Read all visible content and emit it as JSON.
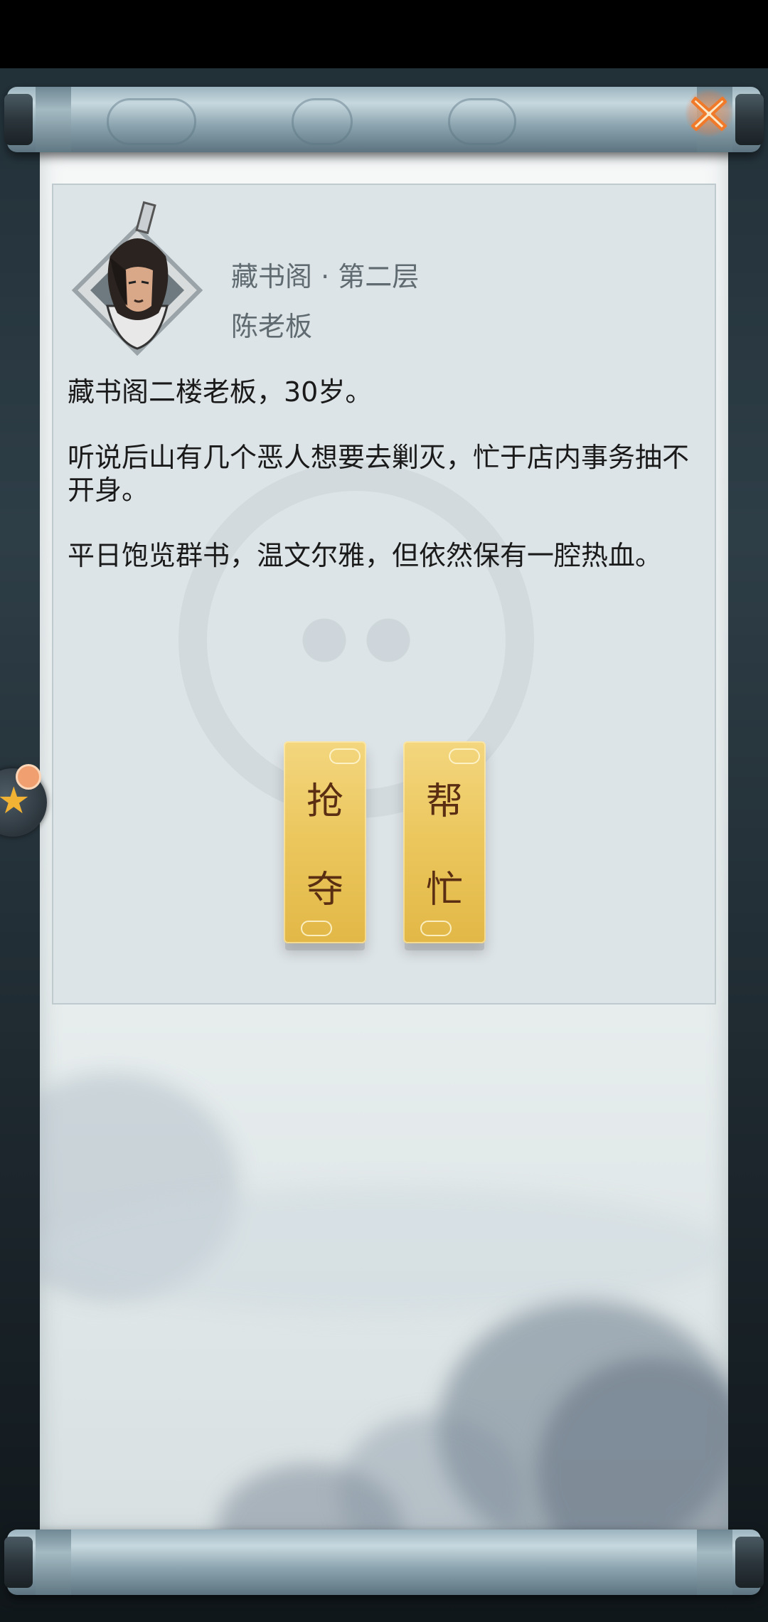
{
  "panel": {
    "location": "藏书阁 · 第二层",
    "npc_name": "陈老板"
  },
  "description": [
    "藏书阁二楼老板，30岁。",
    "听说后山有几个恶人想要去剿灭，忙于店内事务抽不开身。",
    "平日饱览群书，温文尔雅，但依然保有一腔热血。"
  ],
  "actions": {
    "rob": [
      "抢",
      "夺"
    ],
    "help": [
      "帮",
      "忙"
    ]
  },
  "colors": {
    "button_gold": "#ebc65c",
    "button_text": "#5a2e12",
    "close_orange": "#f28b3a"
  },
  "icons": {
    "close": "close-icon",
    "avatar": "npc-portrait",
    "side_widget": "star-icon"
  }
}
